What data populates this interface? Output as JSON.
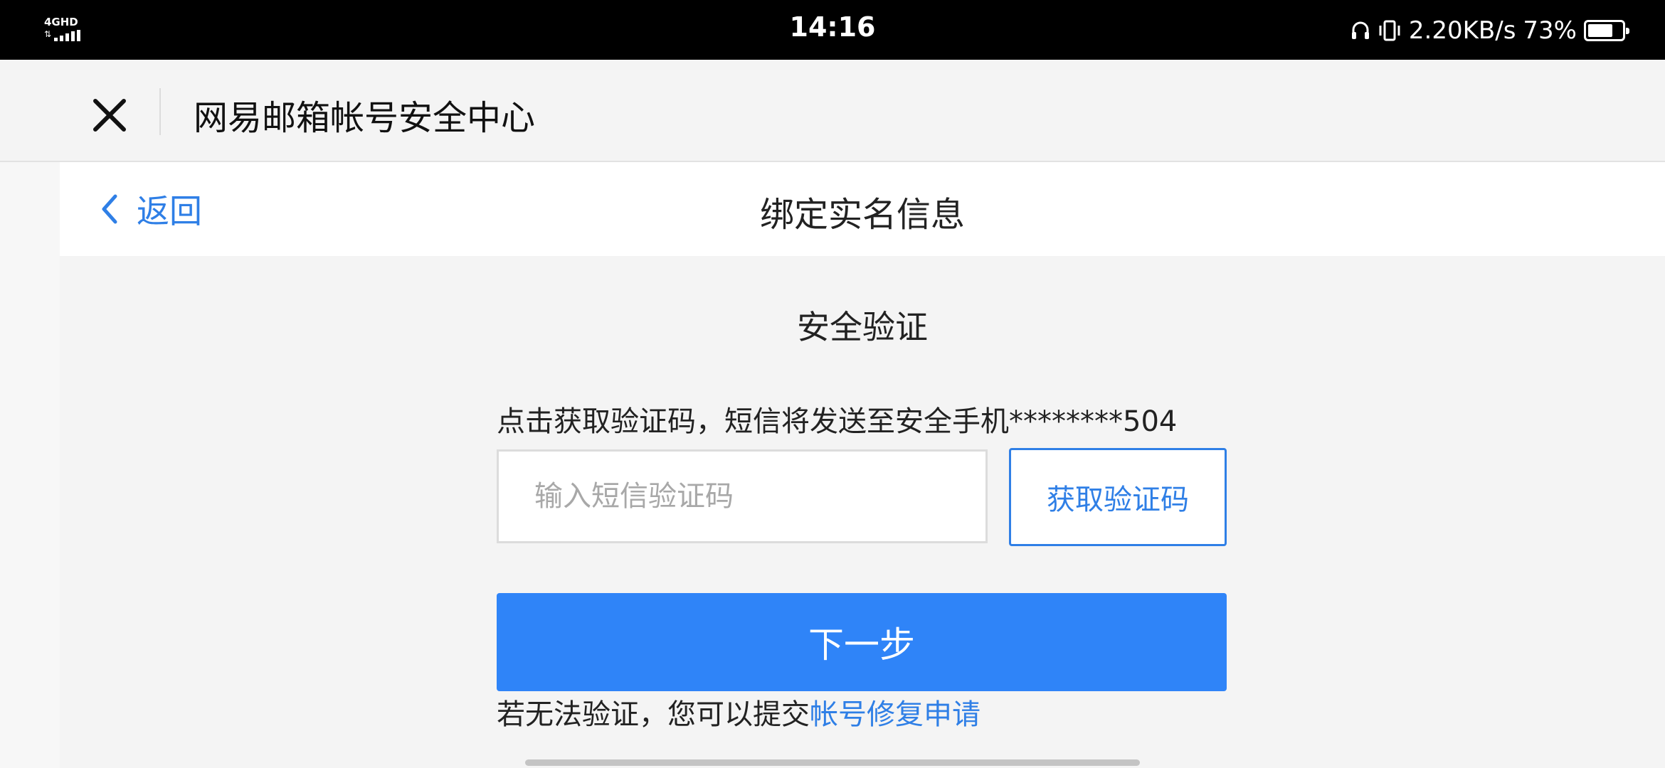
{
  "status_bar": {
    "network": "4GHD",
    "time": "14:16",
    "speed": "2.20KB/s",
    "battery_percent": "73%",
    "battery_level": 0.73,
    "icons": [
      "headphones-icon",
      "vibrate-icon",
      "battery-icon",
      "signal-icon"
    ]
  },
  "header": {
    "title": "网易邮箱帐号安全中心",
    "close_icon": "close-icon"
  },
  "page_nav": {
    "back_label": "返回",
    "title": "绑定实名信息"
  },
  "verify": {
    "section_title": "安全验证",
    "hint": "点击获取验证码，短信将发送至安全手机********504",
    "input_value": "",
    "input_placeholder": "输入短信验证码",
    "get_code_label": "获取验证码",
    "next_label": "下一步",
    "footer_text": "若无法验证，您可以提交",
    "footer_link": "帐号修复申请"
  },
  "colors": {
    "accent": "#2f7fe6",
    "primary_button": "#2f84f8",
    "background": "#f4f4f4"
  }
}
